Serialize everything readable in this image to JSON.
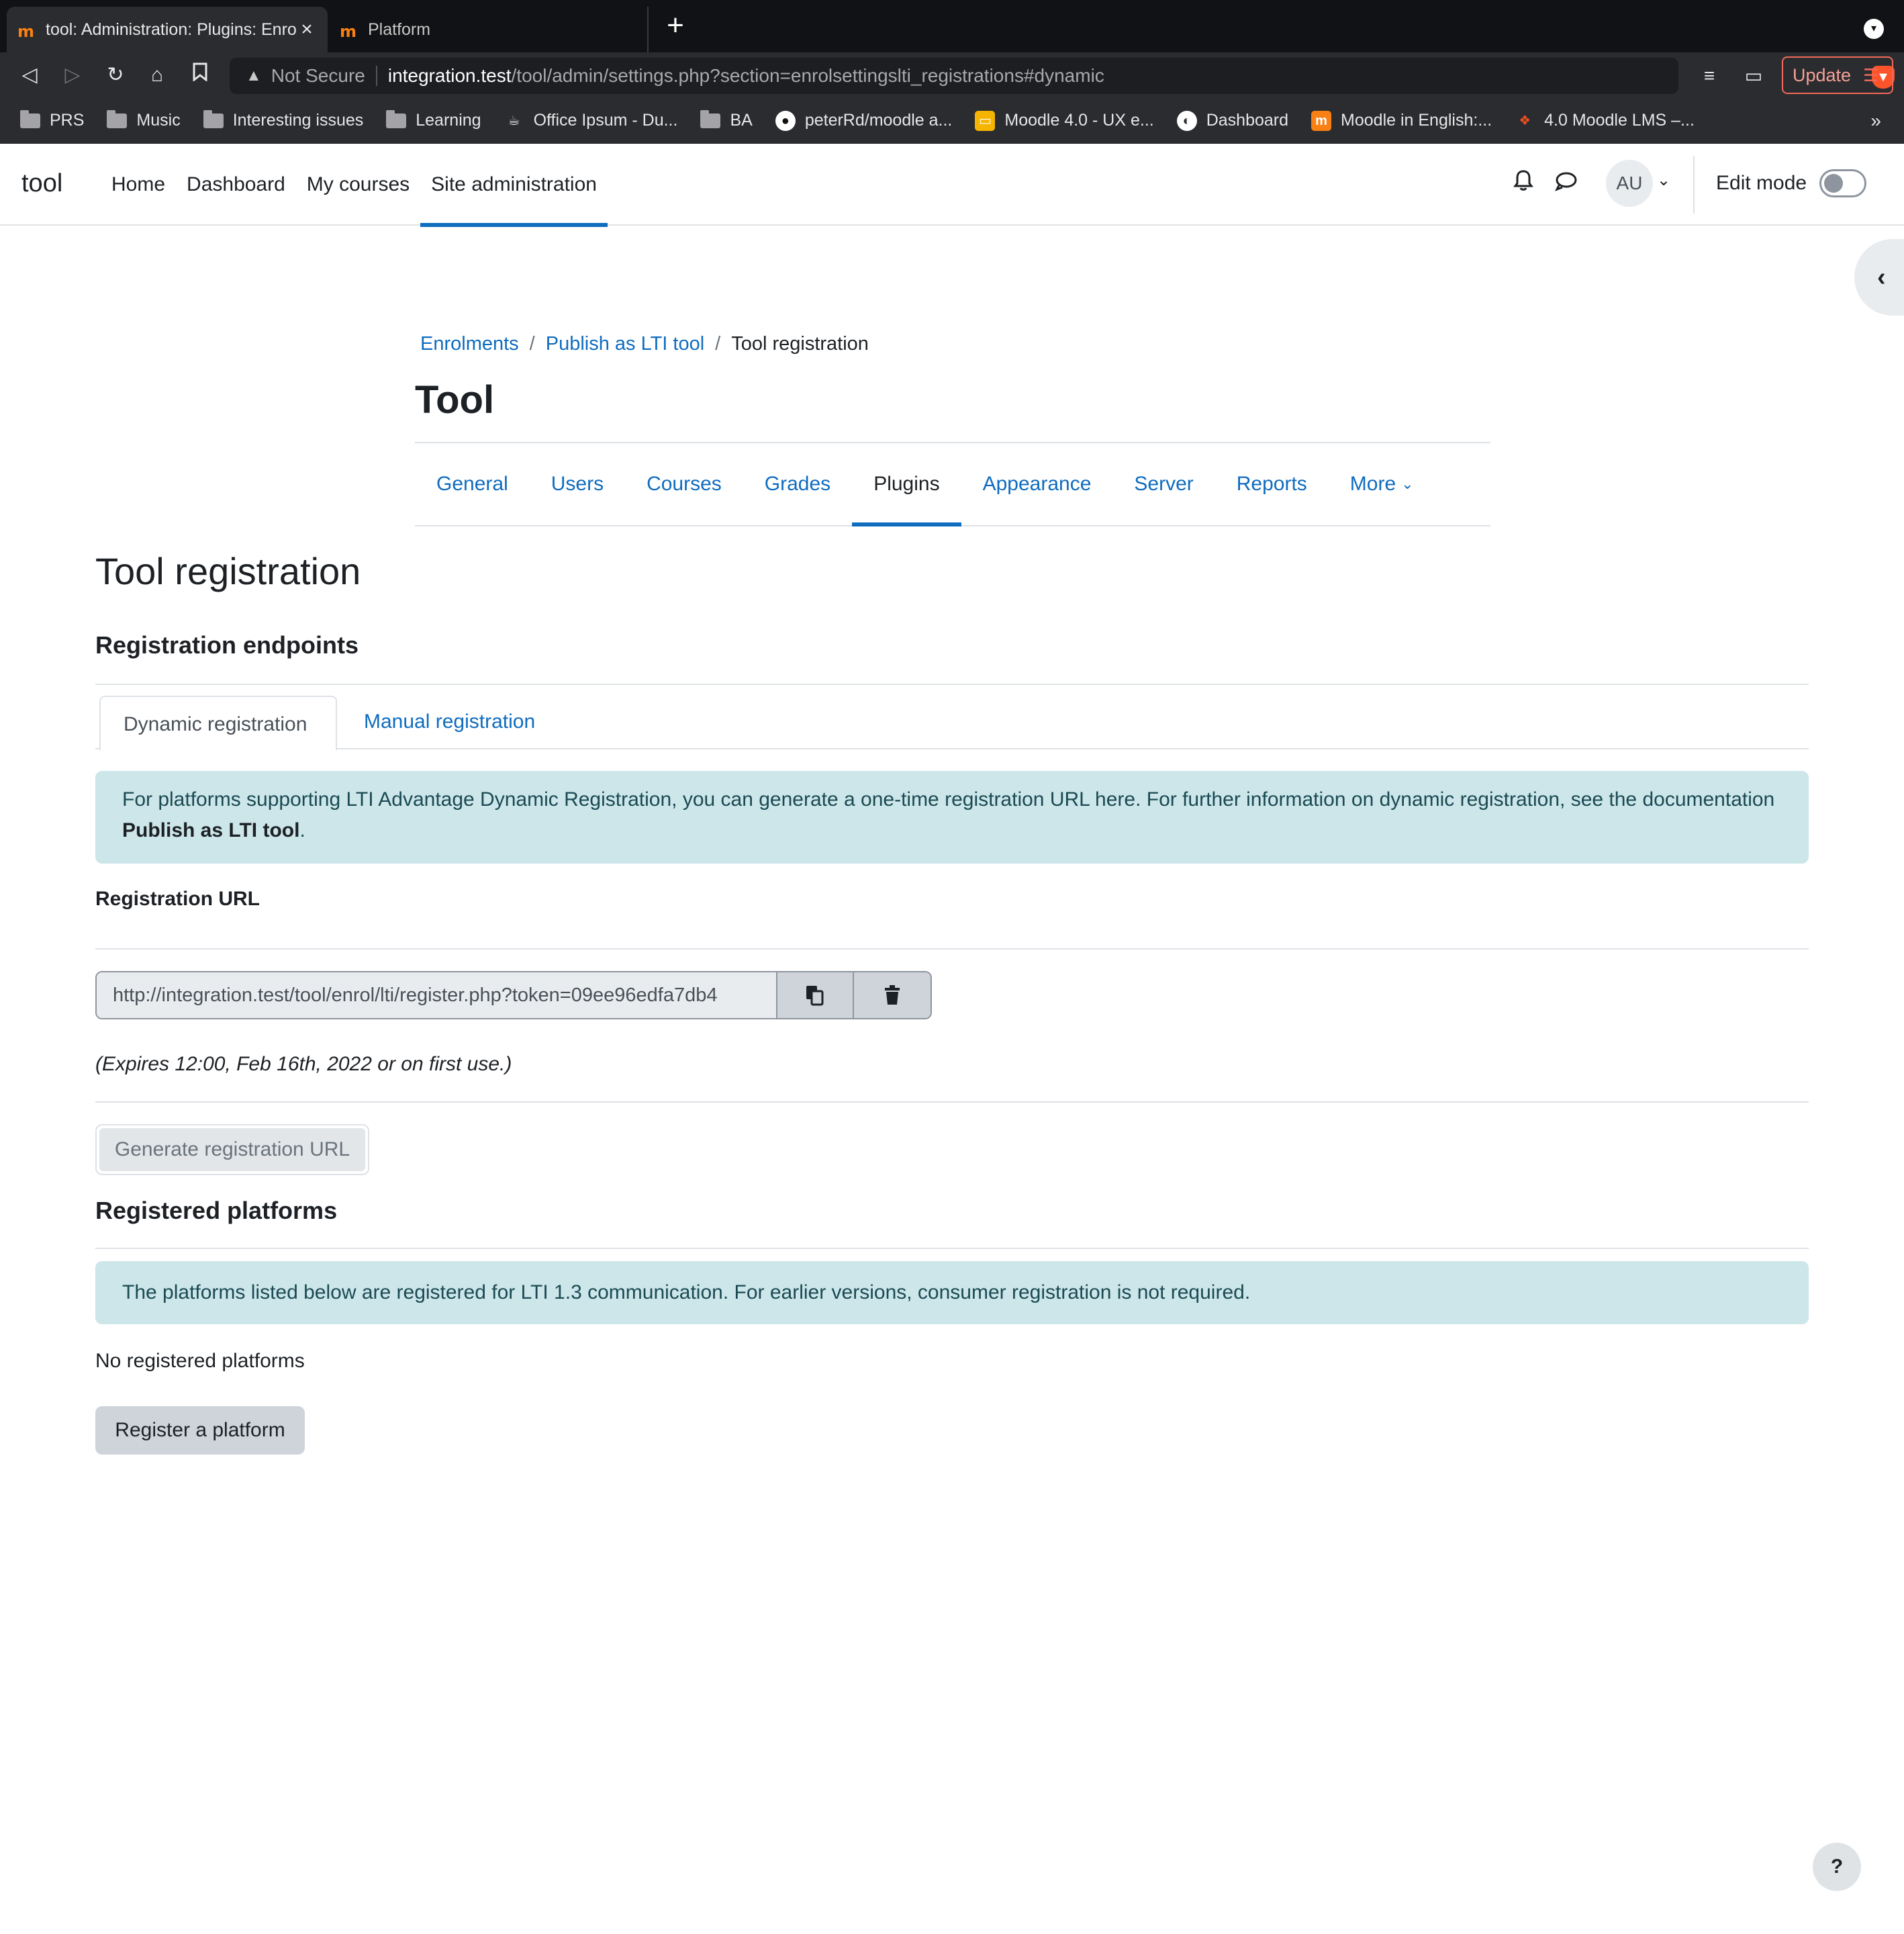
{
  "browser": {
    "tabs": [
      {
        "title": "tool: Administration: Plugins: Enrolments",
        "active": true
      },
      {
        "title": "Platform",
        "active": false
      }
    ],
    "url": {
      "warning": "Not Secure",
      "host": "integration.test",
      "path": "/tool/admin/settings.php?section=enrolsettingslti_registrations#dynamic"
    },
    "update_label": "Update",
    "bookmarks": [
      {
        "label": "PRS",
        "icon": "folder-icon"
      },
      {
        "label": "Music",
        "icon": "folder-icon"
      },
      {
        "label": "Interesting issues",
        "icon": "folder-icon"
      },
      {
        "label": "Learning",
        "icon": "folder-icon"
      },
      {
        "label": "Office Ipsum - Du...",
        "icon": "coffee-icon"
      },
      {
        "label": "BA",
        "icon": "folder-icon"
      },
      {
        "label": "peterRd/moodle a...",
        "icon": "github-icon"
      },
      {
        "label": "Moodle 4.0 - UX e...",
        "icon": "slides-icon"
      },
      {
        "label": "Dashboard",
        "icon": "globe-icon"
      },
      {
        "label": "Moodle in English:...",
        "icon": "moodle-icon"
      },
      {
        "label": "4.0 Moodle LMS –...",
        "icon": "figma-icon"
      }
    ],
    "colors": {
      "chrome_dark": "#111215",
      "chrome": "#2b2c30",
      "update": "#f2685a"
    }
  },
  "navbar": {
    "brand": "tool",
    "items": [
      {
        "label": "Home",
        "active": false
      },
      {
        "label": "Dashboard",
        "active": false
      },
      {
        "label": "My courses",
        "active": false
      },
      {
        "label": "Site administration",
        "active": true
      }
    ],
    "avatar_initials": "AU",
    "edit_mode_label": "Edit mode",
    "edit_mode_on": false
  },
  "header": {
    "breadcrumb": [
      "Enrolments",
      "Publish as LTI tool",
      "Tool registration"
    ],
    "title": "Tool",
    "secondary_nav": [
      {
        "label": "General",
        "active": false
      },
      {
        "label": "Users",
        "active": false
      },
      {
        "label": "Courses",
        "active": false
      },
      {
        "label": "Grades",
        "active": false
      },
      {
        "label": "Plugins",
        "active": true
      },
      {
        "label": "Appearance",
        "active": false
      },
      {
        "label": "Server",
        "active": false
      },
      {
        "label": "Reports",
        "active": false
      },
      {
        "label": "More",
        "active": false
      }
    ]
  },
  "main": {
    "heading": "Tool registration",
    "endpoints_heading": "Registration endpoints",
    "tabs": {
      "dynamic": "Dynamic registration",
      "manual": "Manual registration"
    },
    "dynamic_info_text": "For platforms supporting LTI Advantage Dynamic Registration, you can generate a one-time registration URL here. For further information on dynamic registration, see the documentation ",
    "dynamic_info_link": "Publish as LTI tool",
    "dynamic_info_end": ".",
    "registration_url_label": "Registration URL",
    "registration_url_value": "http://integration.test/tool/enrol/lti/register.php?token=09ee96edfa7db4",
    "expires": "(Expires 12:00, Feb 16th, 2022 or on first use.)",
    "generate_button": "Generate registration URL",
    "registered_heading": "Registered platforms",
    "registered_info": "The platforms listed below are registered for LTI 1.3 communication. For earlier versions, consumer registration is not required.",
    "no_platforms": "No registered platforms",
    "register_button": "Register a platform",
    "colors": {
      "link": "#0f6cbf",
      "alert_bg": "#cce6ea",
      "alert_text": "#1b4a52"
    }
  },
  "help_label": "?"
}
